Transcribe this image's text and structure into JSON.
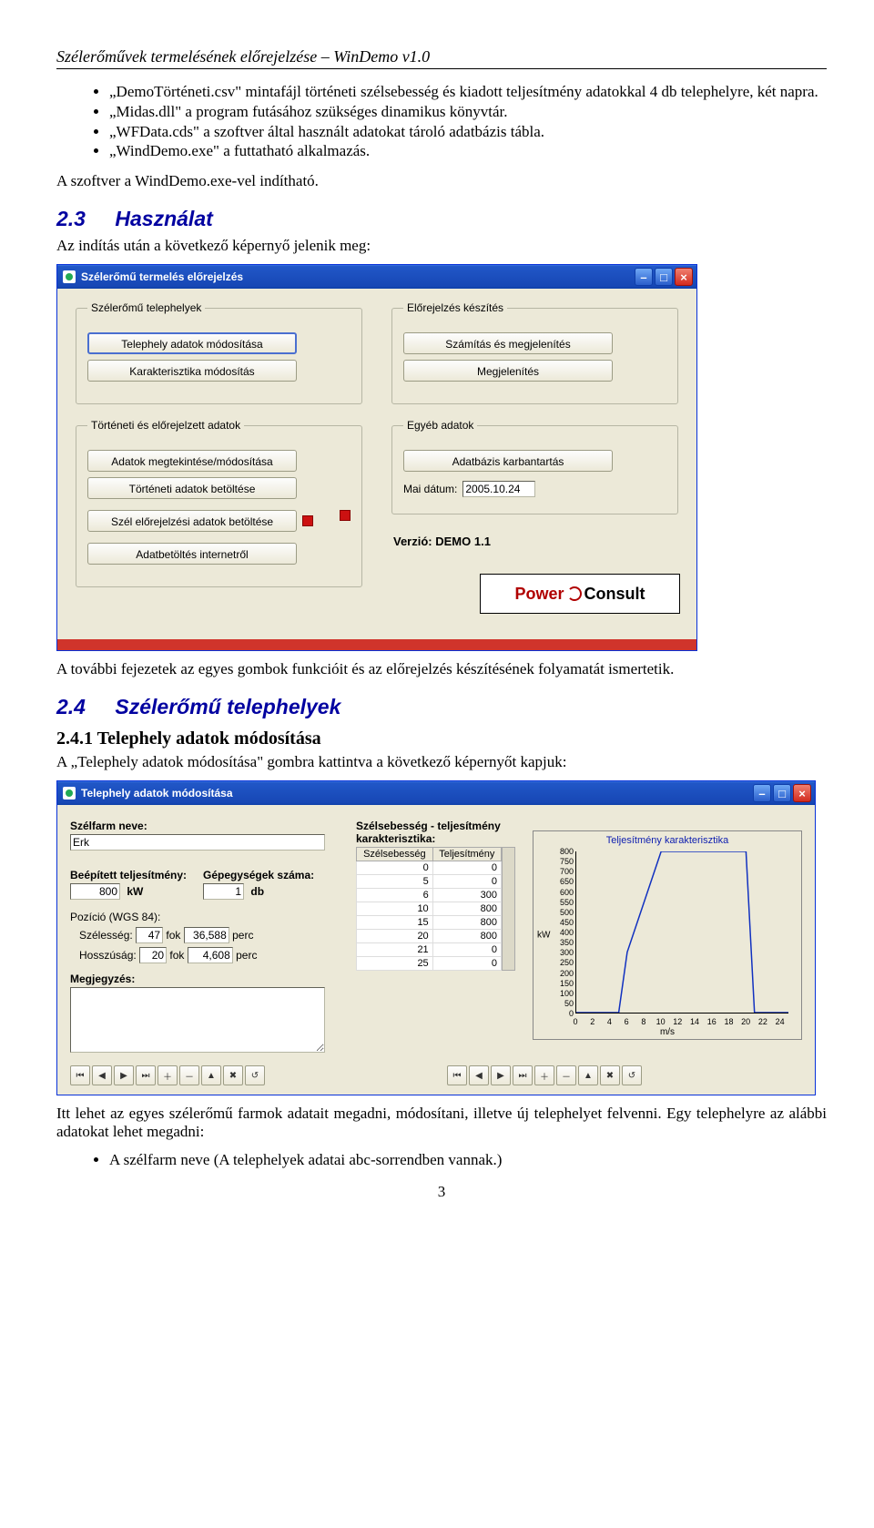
{
  "doc": {
    "header": "Szélerőművek termelésének előrejelzése – WinDemo v1.0",
    "page_number": "3"
  },
  "bullets": [
    "„DemoTörténeti.csv\" mintafájl történeti szélsebesség és kiadott teljesítmény adatokkal 4 db telephelyre, két napra.",
    "„Midas.dll\" a program futásához szükséges dinamikus könyvtár.",
    "„WFData.cds\" a szoftver által használt adatokat tároló adatbázis tábla.",
    "„WindDemo.exe\" a futtatható alkalmazás."
  ],
  "body": {
    "p1": "A szoftver a WindDemo.exe-vel indítható.",
    "p2": "Az indítás után a következő képernyő jelenik meg:",
    "p3": "A további fejezetek az egyes gombok funkcióit és az előrejelzés készítésének folyamatát ismertetik.",
    "p4": "A „Telephely adatok módosítása\" gombra kattintva a következő képernyőt kapjuk:",
    "p5": "Itt lehet az egyes szélerőmű farmok adatait megadni, módosítani, illetve új telephelyet felvenni. Egy telephelyre az alábbi adatokat lehet megadni:",
    "p6": "A szélfarm neve (A telephelyek adatai abc-sorrendben vannak.)"
  },
  "sec": {
    "s23_num": "2.3",
    "s23_title": "Használat",
    "s24_num": "2.4",
    "s24_title": "Szélerőmű telephelyek",
    "s241": "2.4.1  Telephely adatok módosítása"
  },
  "win1": {
    "title": "Szélerőmű termelés előrejelzés",
    "g1": "Szélerőmű telephelyek",
    "b1": "Telephely adatok módosítása",
    "b2": "Karakterisztika módosítás",
    "g2": "Előrejelzés készítés",
    "b3": "Számítás és megjelenítés",
    "b4": "Megjelenítés",
    "g3": "Történeti és előrejelzett adatok",
    "b5": "Adatok megtekintése/módosítása",
    "b6": "Történeti adatok betöltése",
    "b7": "Szél előrejelzési adatok betöltése",
    "b8": "Adatbetöltés internetről",
    "g4": "Egyéb adatok",
    "b9": "Adatbázis karbantartás",
    "date_lbl": "Mai dátum:",
    "date_val": "2005.10.24",
    "version": "Verzió: DEMO 1.1",
    "logo1": "Power",
    "logo2": "Consult"
  },
  "win2": {
    "title": "Telephely adatok módosítása",
    "szelfarm_lbl": "Szélfarm neve:",
    "szelfarm_val": "Erk",
    "beep_lbl": "Beépített teljesítmény:",
    "beep_val": "800",
    "beep_unit": "kW",
    "gep_lbl": "Gépegységek száma:",
    "gep_val": "1",
    "gep_unit": "db",
    "poz_lbl": "Pozíció (WGS 84):",
    "szel_lbl": "Szélesség:",
    "szel_fok": "47",
    "szel_perc": "36,588",
    "hossz_lbl": "Hosszúság:",
    "hossz_fok": "20",
    "hossz_perc": "4,608",
    "fok": "fok",
    "perc": "perc",
    "meg_lbl": "Megjegyzés:",
    "karak_lbl": "Szélsebesség - teljesítmény karakterisztika:",
    "col1": "Szélsebesség",
    "col2": "Teljesítmény",
    "chart_title": "Teljesítmény karakterisztika",
    "yunit": "kW",
    "xunit": "m/s"
  },
  "chart_data": {
    "type": "line",
    "title": "Teljesítmény karakterisztika",
    "xlabel": "m/s",
    "ylabel": "kW",
    "xlim": [
      0,
      25
    ],
    "ylim": [
      0,
      800
    ],
    "x_ticks": [
      0,
      2,
      4,
      6,
      8,
      10,
      12,
      14,
      16,
      18,
      20,
      22,
      24
    ],
    "y_ticks": [
      0,
      50,
      100,
      150,
      200,
      250,
      300,
      350,
      400,
      450,
      500,
      550,
      600,
      650,
      700,
      750,
      800
    ],
    "series": [
      {
        "name": "Teljesítmény",
        "x": [
          0,
          5,
          6,
          10,
          15,
          20,
          21,
          25
        ],
        "y": [
          0,
          0,
          300,
          800,
          800,
          800,
          0,
          0
        ]
      }
    ],
    "table": {
      "columns": [
        "Szélsebesség",
        "Teljesítmény"
      ],
      "rows": [
        [
          0,
          0
        ],
        [
          5,
          0
        ],
        [
          6,
          300
        ],
        [
          10,
          800
        ],
        [
          15,
          800
        ],
        [
          20,
          800
        ],
        [
          21,
          0
        ],
        [
          25,
          0
        ]
      ]
    }
  },
  "nav": [
    "⏮",
    "◀",
    "▶",
    "⏭",
    "＋",
    "－",
    "▲",
    "✖",
    "↺"
  ]
}
